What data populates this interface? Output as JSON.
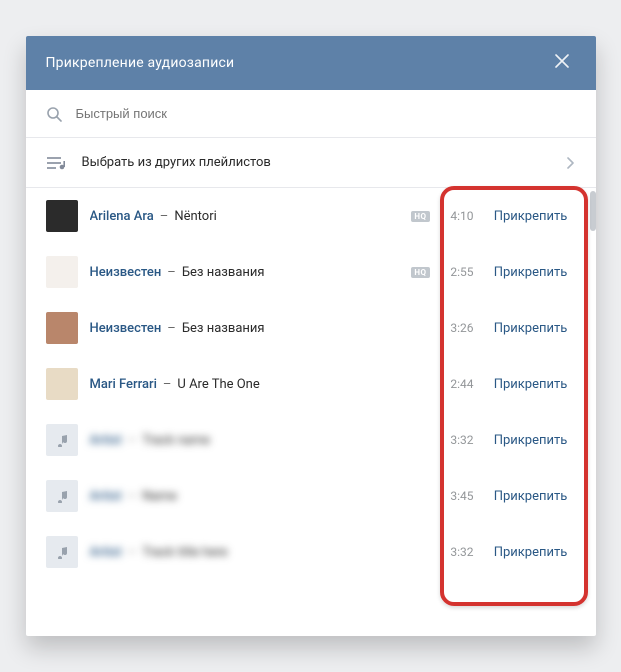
{
  "modal": {
    "title": "Прикрепление аудиозаписи"
  },
  "search": {
    "placeholder": "Быстрый поиск"
  },
  "playlist_select": {
    "label": "Выбрать из других плейлистов"
  },
  "hq_label": "HQ",
  "attach_label": "Прикрепить",
  "tracks": [
    {
      "artist": "Arilena Ara",
      "title": "Nëntori",
      "duration": "4:10",
      "hq": true,
      "thumb": "dark",
      "blurred": false
    },
    {
      "artist": "Неизвестен",
      "title": "Без названия",
      "duration": "2:55",
      "hq": true,
      "thumb": "light",
      "blurred": false
    },
    {
      "artist": "Неизвестен",
      "title": "Без названия",
      "duration": "3:26",
      "hq": false,
      "thumb": "photo",
      "blurred": false
    },
    {
      "artist": "Mari Ferrari",
      "title": "U Are The One",
      "duration": "2:44",
      "hq": false,
      "thumb": "art",
      "blurred": false
    },
    {
      "artist": "Artist",
      "title": "Track name",
      "duration": "3:32",
      "hq": false,
      "thumb": "note",
      "blurred": true
    },
    {
      "artist": "Artist",
      "title": "Name",
      "duration": "3:45",
      "hq": false,
      "thumb": "note",
      "blurred": true
    },
    {
      "artist": "Artist",
      "title": "Track title here",
      "duration": "3:32",
      "hq": false,
      "thumb": "note",
      "blurred": true
    }
  ]
}
